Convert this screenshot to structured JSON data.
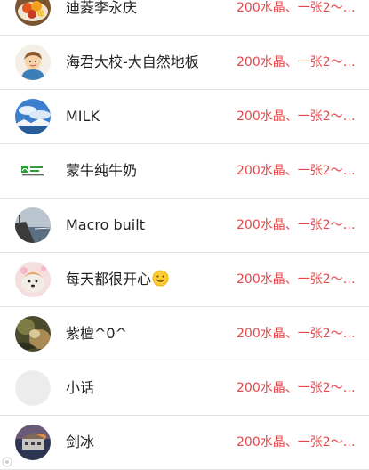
{
  "contacts": [
    {
      "name": "迪菱李永庆",
      "gift": "200水晶、一张2～…",
      "avatar_icon": "fruit-plate-avatar-icon"
    },
    {
      "name": "海君大校-大自然地板",
      "gift": "200水晶、一张2～…",
      "avatar_icon": "cartoon-boy-avatar-icon"
    },
    {
      "name": "MILK",
      "gift": "200水晶、一张2～…",
      "avatar_icon": "sky-landscape-avatar-icon"
    },
    {
      "name": "蒙牛纯牛奶",
      "gift": "200水晶、一张2～…",
      "avatar_icon": "mengniu-logo-avatar-icon"
    },
    {
      "name": "Macro built",
      "gift": "200水晶、一张2～…",
      "avatar_icon": "seaside-avatar-icon"
    },
    {
      "name": "每天都很开心",
      "gift": "200水晶、一张2～…",
      "avatar_icon": "dog-avatar-icon",
      "emoji": "smiley-emoji-icon"
    },
    {
      "name": "紫檀^0^",
      "gift": "200水晶、一张2～…",
      "avatar_icon": "nature-avatar-icon"
    },
    {
      "name": "小话",
      "gift": "200水晶、一张2～…",
      "avatar_icon": "blank-avatar-icon"
    },
    {
      "name": "剑冰",
      "gift": "200水晶、一张2～…",
      "avatar_icon": "sunset-building-avatar-icon"
    }
  ],
  "colors": {
    "gift_text": "#e5474a",
    "name_text": "#222222",
    "divider": "#e4e4e4"
  }
}
